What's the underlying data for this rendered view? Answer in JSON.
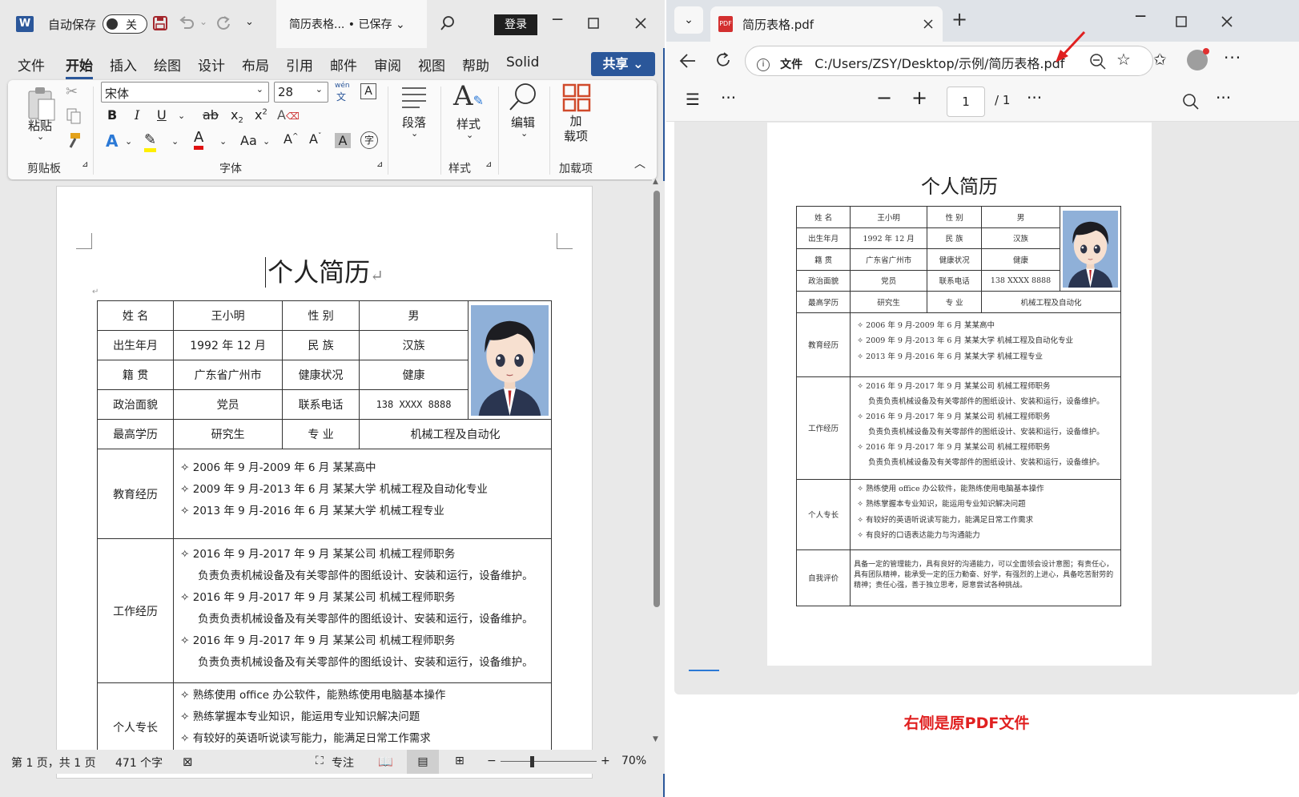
{
  "word": {
    "autosave_label": "自动保存",
    "autosave_state": "关",
    "doc_name": "简历表格... • 已保存 ⌄",
    "login_label": "登录",
    "tabs": [
      "文件",
      "开始",
      "插入",
      "绘图",
      "设计",
      "布局",
      "引用",
      "邮件",
      "审阅",
      "视图",
      "帮助",
      "Solid"
    ],
    "share_label": "共享 ⌄",
    "ribbon": {
      "paste_label": "粘贴",
      "clipboard_group": "剪贴板",
      "font_name": "宋体",
      "font_size": "28",
      "wen_label": "wén",
      "font_group": "字体",
      "paragraph_label": "段落",
      "styles_label": "样式",
      "styles_group": "样式",
      "editing_label": "编辑",
      "addins_label": "加\n载项",
      "addins_group": "加载项"
    },
    "document": {
      "title": "个人简历",
      "rows": {
        "name_label": "姓 名",
        "name": "王小明",
        "gender_label": "性 别",
        "gender": "男",
        "birth_label": "出生年月",
        "birth": "1992 年 12 月",
        "ethnic_label": "民 族",
        "ethnic": "汉族",
        "origin_label": "籍 贯",
        "origin": "广东省广州市",
        "health_label": "健康状况",
        "health": "健康",
        "political_label": "政治面貌",
        "political": "党员",
        "phone_label": "联系电话",
        "phone": "138 XXXX 8888",
        "edu_label": "最高学历",
        "edu": "研究生",
        "major_label": "专 业",
        "major": "机械工程及自动化"
      },
      "education_label": "教育经历",
      "education": [
        "✧ 2006 年 9 月-2009 年 6 月 某某高中",
        "✧ 2009 年 9 月-2013 年 6 月 某某大学 机械工程及自动化专业",
        "✧ 2013 年 9 月-2016 年 6 月 某某大学 机械工程专业"
      ],
      "work_label": "工作经历",
      "work": [
        "✧ 2016 年 9 月-2017 年 9 月 某某公司 机械工程师职务",
        "负责负责机械设备及有关零部件的图纸设计、安装和运行，设备维护。",
        "✧ 2016 年 9 月-2017 年 9 月 某某公司 机械工程师职务",
        "负责负责机械设备及有关零部件的图纸设计、安装和运行，设备维护。",
        "✧ 2016 年 9 月-2017 年 9 月 某某公司 机械工程师职务",
        "负责负责机械设备及有关零部件的图纸设计、安装和运行，设备维护。"
      ],
      "skills_label": "个人专长",
      "skills": [
        "✧ 熟练使用 office 办公软件，能熟练使用电脑基本操作",
        "✧ 熟练掌握本专业知识，能运用专业知识解决问题",
        "✧ 有较好的英语听说读写能力，能满足日常工作需求"
      ]
    },
    "status": {
      "page": "第 1 页，共 1 页",
      "words": "471 个字",
      "focus": "专注",
      "zoom": "70%"
    }
  },
  "edge": {
    "tab_title": "简历表格.pdf",
    "address_prefix": "文件",
    "address": "C:/Users/ZSY/Desktop/示例/简历表格.pdf",
    "page_current": "1",
    "page_total": "/ 1",
    "pdf": {
      "title": "个人简历",
      "rows": {
        "name_label": "姓 名",
        "name": "王小明",
        "gender_label": "性 别",
        "gender": "男",
        "birth_label": "出生年月",
        "birth": "1992 年 12 月",
        "ethnic_label": "民 族",
        "ethnic": "汉族",
        "origin_label": "籍 贯",
        "origin": "广东省广州市",
        "health_label": "健康状况",
        "health": "健康",
        "political_label": "政治面貌",
        "political": "党员",
        "phone_label": "联系电话",
        "phone": "138 XXXX 8888",
        "edu_label": "最高学历",
        "edu": "研究生",
        "major_label": "专 业",
        "major": "机械工程及自动化"
      },
      "education_label": "教育经历",
      "education": [
        "✧ 2006 年 9 月-2009 年 6 月 某某高中",
        "✧ 2009 年 9 月-2013 年 6 月 某某大学 机械工程及自动化专业",
        "✧ 2013 年 9 月-2016 年 6 月 某某大学 机械工程专业"
      ],
      "work_label": "工作经历",
      "work": [
        "✧ 2016 年 9 月-2017 年 9 月 某某公司 机械工程师职务",
        "负责负责机械设备及有关零部件的图纸设计、安装和运行，设备维护。",
        "✧ 2016 年 9 月-2017 年 9 月 某某公司 机械工程师职务",
        "负责负责机械设备及有关零部件的图纸设计、安装和运行，设备维护。",
        "✧ 2016 年 9 月-2017 年 9 月 某某公司 机械工程师职务",
        "负责负责机械设备及有关零部件的图纸设计、安装和运行，设备维护。"
      ],
      "skills_label": "个人专长",
      "skills": [
        "✧ 熟练使用 office 办公软件，能熟练使用电脑基本操作",
        "✧ 熟练掌握本专业知识，能运用专业知识解决问题",
        "✧ 有较好的英语听说读写能力，能满足日常工作需求",
        "✧ 有良好的口语表达能力与沟通能力"
      ],
      "self_label": "自我评价",
      "self_eval": "具备一定的管理能力，具有良好的沟通能力，可以全面领会设计意图；有责任心，具有团队精神，能承受一定的压力勤奋、好学，有强烈的上进心，具备吃苦耐劳的精神；责任心强，善于独立思考，愿意尝试各种挑战。"
    },
    "note": "右侧是原PDF文件"
  },
  "colors": {
    "word_blue": "#2b579a",
    "note_red": "#e02020",
    "avatar_bg": "#8fb0d8"
  }
}
